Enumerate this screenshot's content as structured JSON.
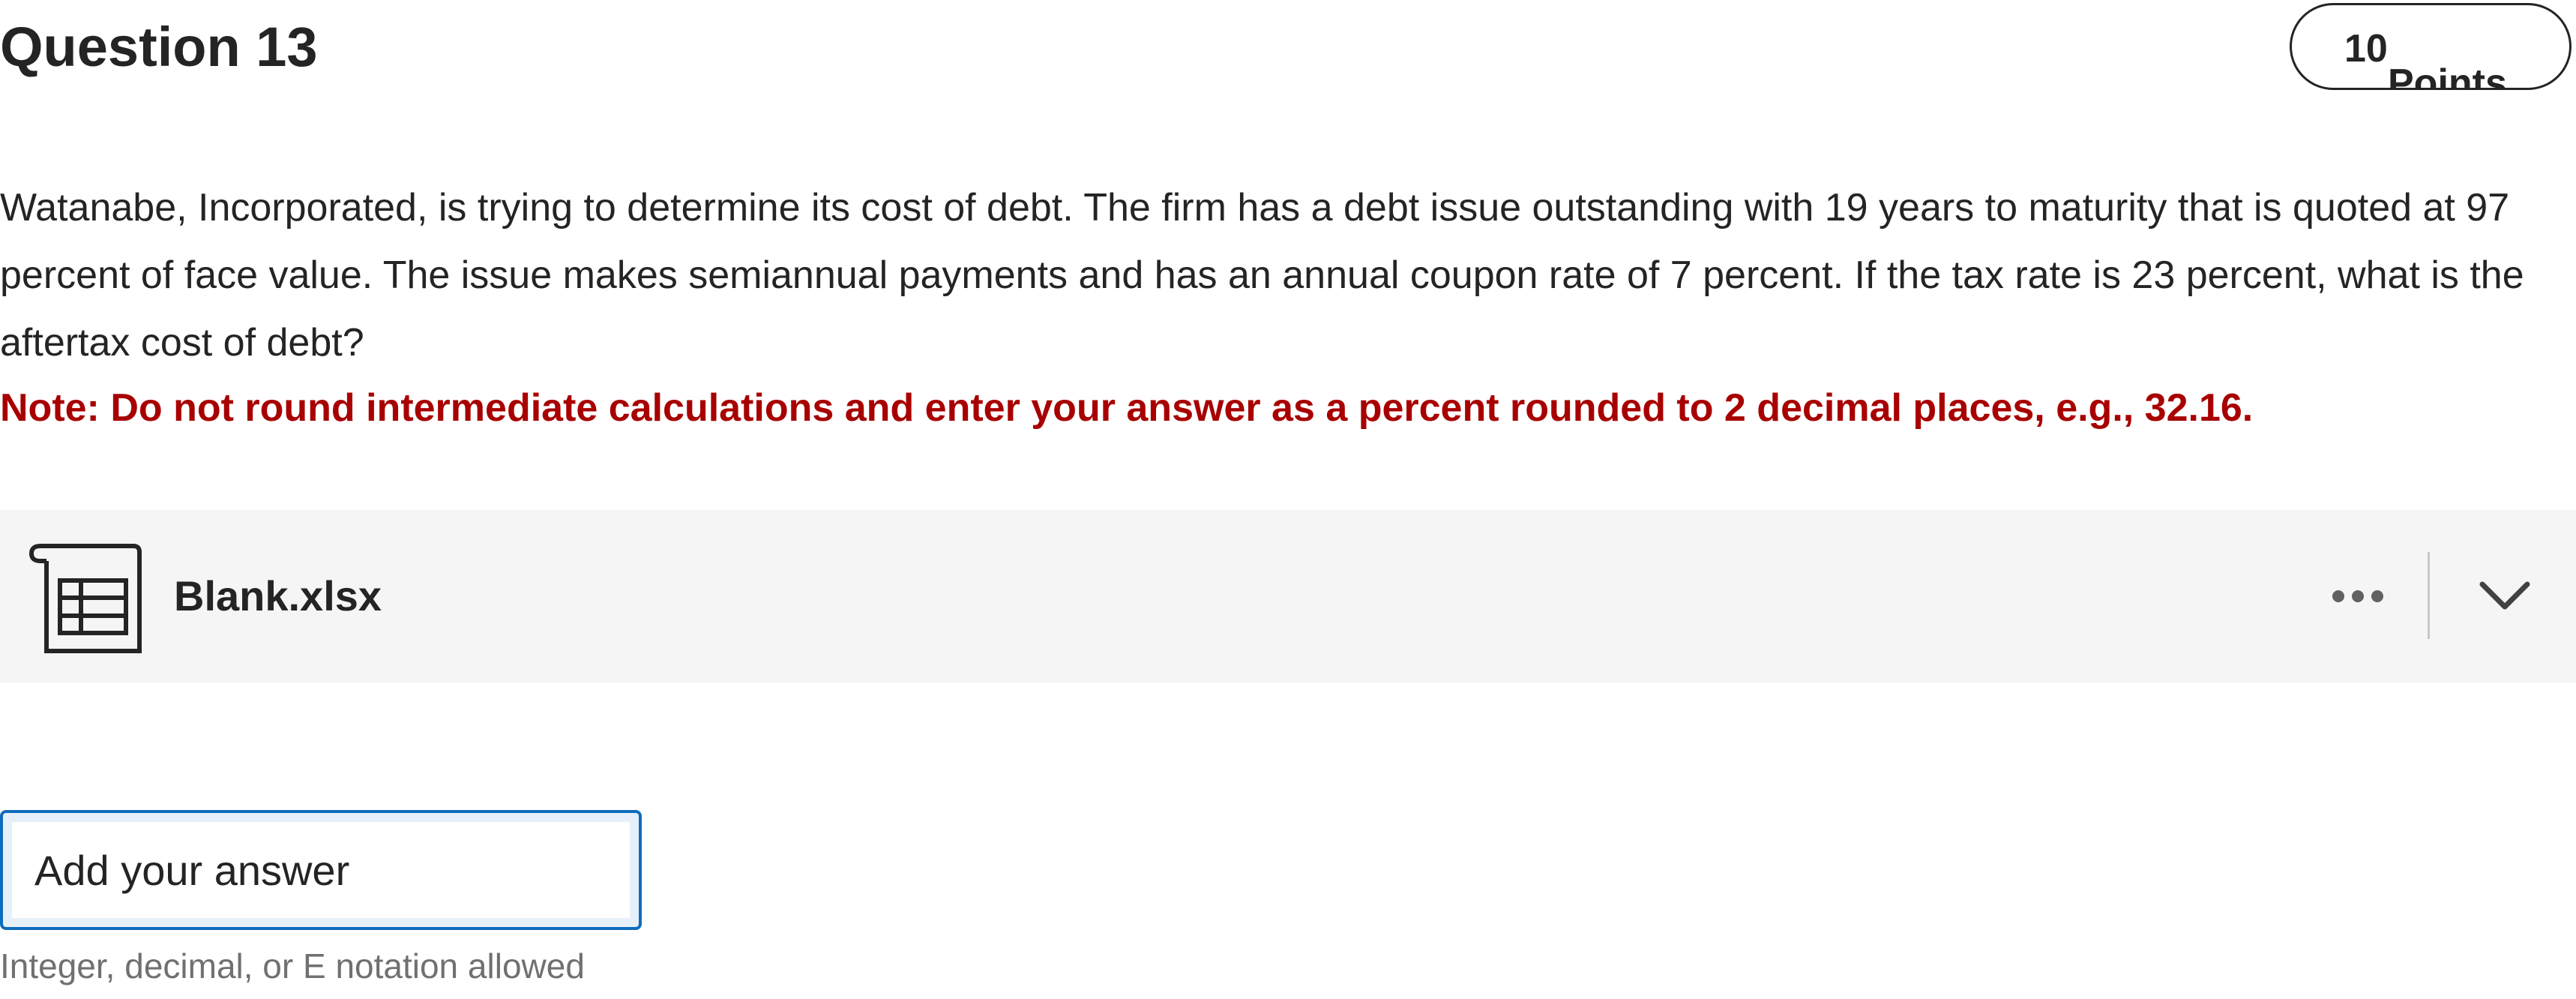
{
  "question": {
    "title": "Question 13",
    "points_value": "10",
    "points_label": "Points",
    "body": "Watanabe, Incorporated, is trying to determine its cost of debt. The firm has a debt issue outstanding with 19 years to maturity that is quoted at 97 percent of face value. The issue makes semiannual payments and has an annual coupon rate of 7 percent. If the tax rate is 23 percent, what is the aftertax cost of debt?",
    "note": "Note: Do not round intermediate calculations and enter your answer as a percent rounded to 2 decimal places, e.g., 32.16."
  },
  "attachment": {
    "file_name": "Blank.xlsx",
    "icon": "spreadsheet-file-icon",
    "more_icon": "more-options-icon",
    "expand_icon": "chevron-down-icon"
  },
  "answer": {
    "placeholder": "Add your answer",
    "value": "",
    "hint": "Integer, decimal, or E notation allowed"
  },
  "colors": {
    "note_text": "#a80000",
    "input_focus_border": "#0f6cbd",
    "attachment_bg": "#f5f5f5",
    "hint_text": "#707070"
  }
}
